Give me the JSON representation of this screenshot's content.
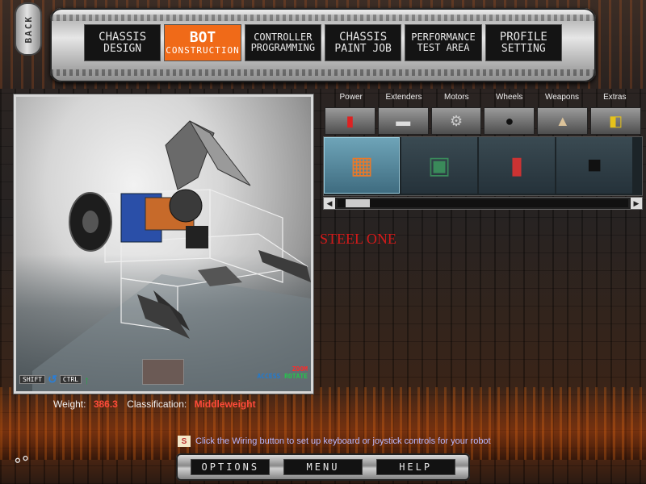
{
  "back": {
    "label": "BACK"
  },
  "nav": {
    "tabs": [
      {
        "line1": "CHASSIS",
        "line2": "DESIGN",
        "active": false
      },
      {
        "line1": "BOT",
        "line2": "CONSTRUCTION",
        "active": true
      },
      {
        "line1": "CONTROLLER",
        "line2": "PROGRAMMING",
        "active": false
      },
      {
        "line1": "CHASSIS",
        "line2": "PAINT JOB",
        "active": false
      },
      {
        "line1": "PERFORMANCE",
        "line2": "TEST AREA",
        "active": false
      },
      {
        "line1": "PROFILE",
        "line2": "SETTING",
        "active": false
      }
    ]
  },
  "viewport": {
    "hints": {
      "shift": "SHIFT",
      "ctrl": "CTRL",
      "zoom": "ZOOM",
      "access": "ACCESS",
      "rotate": "ROTATE"
    }
  },
  "stats": {
    "weight_label": "Weight:",
    "weight_value": "386.3",
    "class_label": "Classification:",
    "class_value": "Middleweight"
  },
  "categories": [
    {
      "label": "Power",
      "icon": "battery-icon"
    },
    {
      "label": "Extenders",
      "icon": "extender-bar-icon"
    },
    {
      "label": "Motors",
      "icon": "motor-icon"
    },
    {
      "label": "Wheels",
      "icon": "wheel-icon"
    },
    {
      "label": "Weapons",
      "icon": "spike-icon"
    },
    {
      "label": "Extras",
      "icon": "hazard-plate-icon"
    }
  ],
  "parts": [
    {
      "icon": "orange-circuit-board-icon",
      "selected": true
    },
    {
      "icon": "green-chip-icon",
      "selected": false
    },
    {
      "icon": "battery-can-icon",
      "selected": false
    },
    {
      "icon": "black-box-icon",
      "selected": false
    }
  ],
  "part_name": "STEEL ONE",
  "tip": "Click the Wiring button to set up keyboard or joystick controls for your robot",
  "footer": {
    "options": "OPTIONS",
    "menu": "MENU",
    "help": "HELP"
  },
  "colors": {
    "accent": "#f06a18",
    "part_name": "#d31a1a",
    "stat_value": "#ff4a3a"
  }
}
